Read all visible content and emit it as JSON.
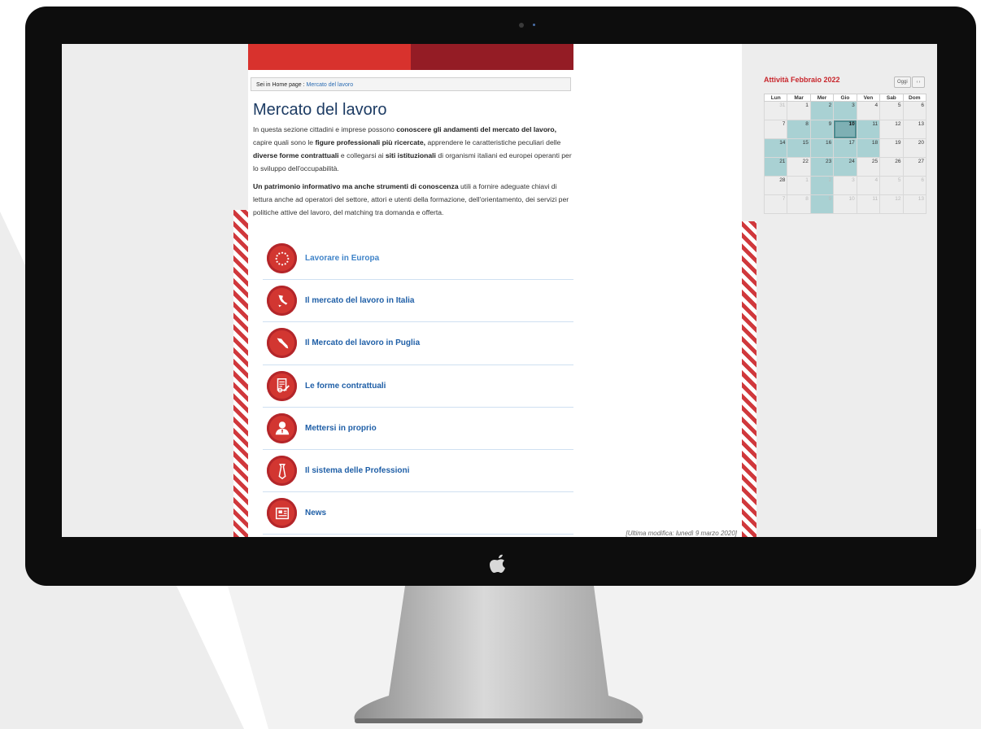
{
  "breadcrumb": {
    "prefix": "Sei in",
    "home": "Home page",
    "sep": ":",
    "current": "Mercato del lavoro"
  },
  "page": {
    "title": "Mercato del lavoro",
    "para1": [
      {
        "t": "In questa sezione cittadini e imprese possono ",
        "b": false
      },
      {
        "t": "conoscere gli andamenti del mercato del lavoro,",
        "b": true
      },
      {
        "t": " capire quali sono le ",
        "b": false
      },
      {
        "t": "figure professionali più ricercate,",
        "b": true
      },
      {
        "t": " apprendere le caratteristiche peculiari delle ",
        "b": false
      },
      {
        "t": "diverse forme contrattuali",
        "b": true
      },
      {
        "t": " e collegarsi ai ",
        "b": false
      },
      {
        "t": "siti istituzionali",
        "b": true
      },
      {
        "t": " di organismi italiani ed europei operanti per lo sviluppo dell'occupabilità.",
        "b": false
      }
    ],
    "para2": [
      {
        "t": "Un patrimonio informativo ma anche strumenti di conoscenza",
        "b": true
      },
      {
        "t": " utili a fornire adeguate chiavi di lettura anche ad operatori del settore, attori e utenti della formazione, dell'orientamento, dei servizi per politiche attive del lavoro, del matching tra domanda e offerta.",
        "b": false
      }
    ],
    "last_modified": "[Ultima modifica: lunedì 9 marzo 2020]"
  },
  "menu": [
    {
      "label": "Lavorare in Europa",
      "icon": "eu-stars-icon"
    },
    {
      "label": "Il mercato del lavoro in Italia",
      "icon": "italy-map-icon"
    },
    {
      "label": "Il Mercato del lavoro in Puglia",
      "icon": "puglia-map-icon"
    },
    {
      "label": "Le forme contrattuali",
      "icon": "contract-document-icon"
    },
    {
      "label": "Mettersi in proprio",
      "icon": "businessman-icon"
    },
    {
      "label": "Il sistema delle Professioni",
      "icon": "tie-icon"
    },
    {
      "label": "News",
      "icon": "newspaper-icon"
    }
  ],
  "calendar": {
    "title": "Attività Febbraio 2022",
    "today_button": "Oggi",
    "nav_label": "‹ ›",
    "weekdays": [
      "Lun",
      "Mar",
      "Mer",
      "Gio",
      "Ven",
      "Sab",
      "Dom"
    ],
    "weeks": [
      [
        "31",
        "1",
        "2",
        "3",
        "4",
        "5",
        "6"
      ],
      [
        "7",
        "8",
        "9",
        "10",
        "11",
        "12",
        "13"
      ],
      [
        "14",
        "15",
        "16",
        "17",
        "18",
        "19",
        "20"
      ],
      [
        "21",
        "22",
        "23",
        "24",
        "25",
        "26",
        "27"
      ],
      [
        "28",
        "1",
        "2",
        "3",
        "4",
        "5",
        "6"
      ],
      [
        "7",
        "8",
        "9",
        "10",
        "11",
        "12",
        "13"
      ]
    ],
    "today": "10",
    "colors": {
      "event": "#a9d1d3",
      "today": "#7eb0b4",
      "accent": "#c8262c"
    }
  },
  "colors": {
    "red": "#d8322d",
    "dark_red": "#941c25",
    "link": "#1f5fa7",
    "title": "#1c3b63"
  }
}
